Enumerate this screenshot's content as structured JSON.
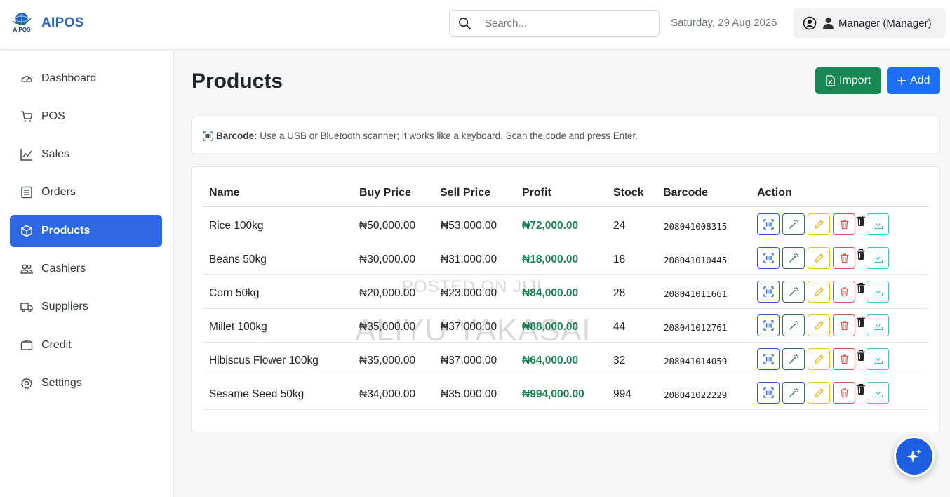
{
  "app": {
    "brand": "AIPOS",
    "logo_text": "AIPOS"
  },
  "header": {
    "search_placeholder": "Search...",
    "date": "Saturday, 29 Aug 2026",
    "user": "Manager (Manager)"
  },
  "sidebar": {
    "items": [
      {
        "label": "Dashboard",
        "icon": "speedometer-icon",
        "active": false
      },
      {
        "label": "POS",
        "icon": "cart-icon",
        "active": false
      },
      {
        "label": "Sales",
        "icon": "line-chart-icon",
        "active": false
      },
      {
        "label": "Orders",
        "icon": "list-icon",
        "active": false
      },
      {
        "label": "Products",
        "icon": "box-icon",
        "active": true
      },
      {
        "label": "Cashiers",
        "icon": "people-icon",
        "active": false
      },
      {
        "label": "Suppliers",
        "icon": "truck-icon",
        "active": false
      },
      {
        "label": "Credit",
        "icon": "wallet-icon",
        "active": false
      },
      {
        "label": "Settings",
        "icon": "gear-icon",
        "active": false
      }
    ]
  },
  "main": {
    "title": "Products",
    "import_label": "Import",
    "add_label": "Add",
    "notice_bold": "Barcode:",
    "notice_text": " Use a USB or Bluetooth scanner; it works like a keyboard. Scan the code and press Enter."
  },
  "table": {
    "columns": [
      "Name",
      "Buy Price",
      "Sell Price",
      "Profit",
      "Stock",
      "Barcode",
      "Action"
    ],
    "rows": [
      {
        "name": "Rice 100kg",
        "buy": "₦50,000.00",
        "sell": "₦53,000.00",
        "profit": "₦72,000.00",
        "stock": "24",
        "barcode": "208041008315"
      },
      {
        "name": "Beans 50kg",
        "buy": "₦30,000.00",
        "sell": "₦31,000.00",
        "profit": "₦18,000.00",
        "stock": "18",
        "barcode": "208041010445"
      },
      {
        "name": "Corn 50kg",
        "buy": "₦20,000.00",
        "sell": "₦23,000.00",
        "profit": "₦84,000.00",
        "stock": "28",
        "barcode": "208041011661"
      },
      {
        "name": "Millet 100kg",
        "buy": "₦35,000.00",
        "sell": "₦37,000.00",
        "profit": "₦88,000.00",
        "stock": "44",
        "barcode": "208041012761"
      },
      {
        "name": "Hibiscus Flower 100kg",
        "buy": "₦35,000.00",
        "sell": "₦37,000.00",
        "profit": "₦64,000.00",
        "stock": "32",
        "barcode": "208041014059"
      },
      {
        "name": "Sesame Seed 50kg",
        "buy": "₦34,000.00",
        "sell": "₦35,000.00",
        "profit": "₦994,000.00",
        "stock": "994",
        "barcode": "208041022229"
      }
    ]
  },
  "watermark": {
    "line1": "POSTED ON JIJI",
    "line2": "ALIYU YAKASAI"
  },
  "colors": {
    "primary": "#2f66e4",
    "success": "#198754",
    "warning": "#f0c017",
    "danger": "#d9534f",
    "info": "#3fbfd6"
  }
}
